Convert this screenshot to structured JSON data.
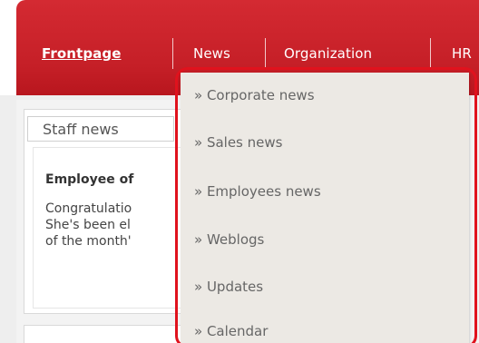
{
  "nav": {
    "items": [
      {
        "label": "Frontpage"
      },
      {
        "label": "News"
      },
      {
        "label": "Organization"
      },
      {
        "label": "HR"
      }
    ]
  },
  "staff_panel": {
    "tab_label": "Staff news",
    "title": "Employee of",
    "lines": [
      "Congratulatio",
      "She's been el",
      "of the month'"
    ]
  },
  "news_menu": {
    "items": [
      {
        "label": "» Corporate news"
      },
      {
        "label": "» Sales news"
      },
      {
        "label": "» Employees news"
      },
      {
        "label": "» Weblogs"
      },
      {
        "label": "» Updates"
      },
      {
        "label": "» Calendar"
      }
    ]
  },
  "colors": {
    "brand_red": "#c51f27",
    "menu_bg": "#ece9e4",
    "highlight": "#e0121d"
  }
}
